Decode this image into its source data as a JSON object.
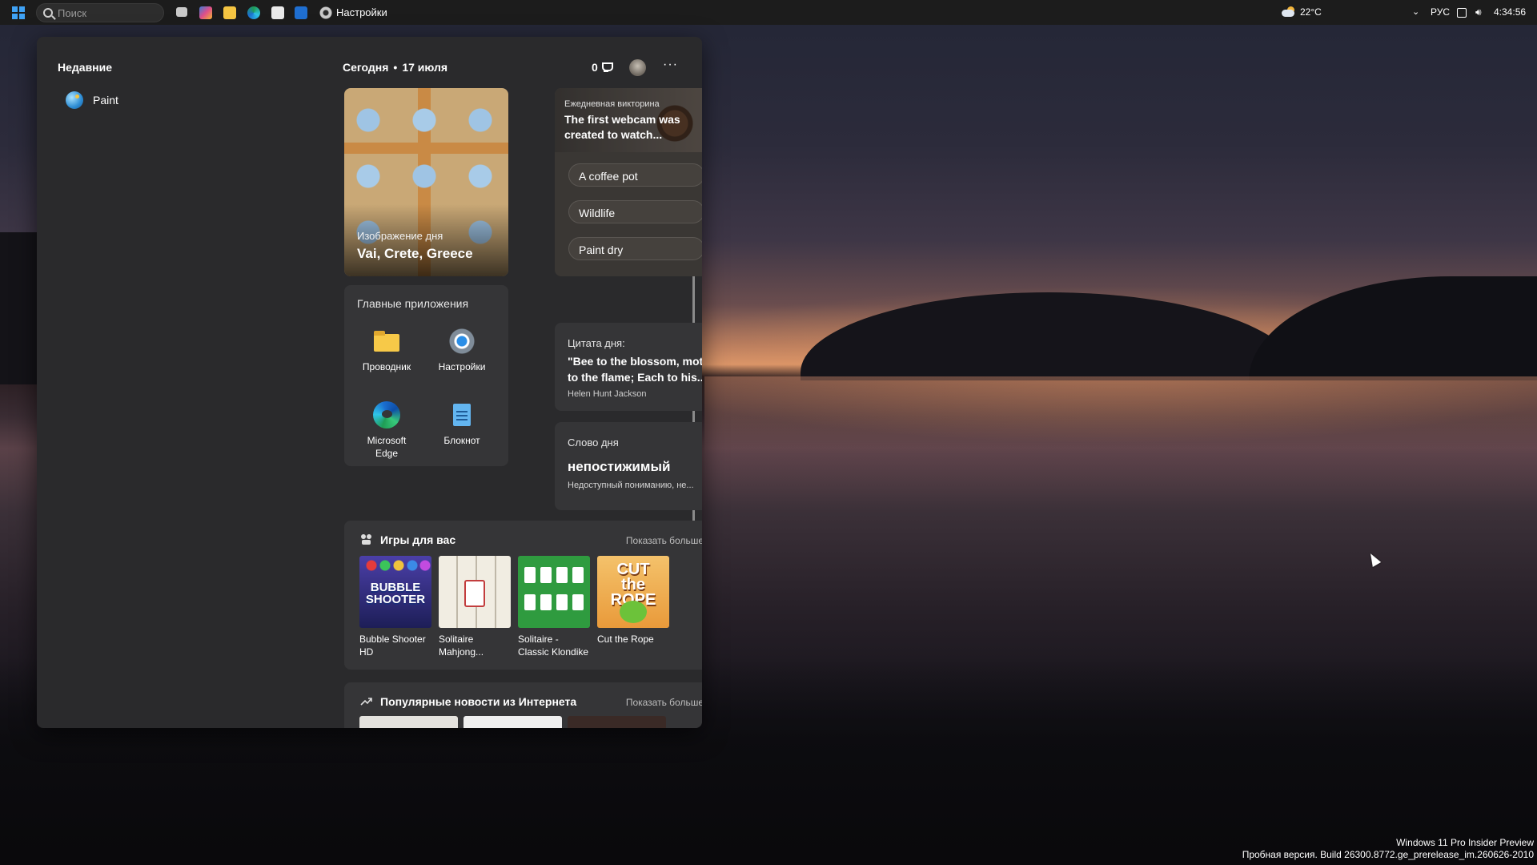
{
  "taskbar": {
    "search_placeholder": "Поиск",
    "active_app_label": "Настройки",
    "weather_temp": "22°C",
    "language": "РУС",
    "time": "4:34:56"
  },
  "widgets": {
    "recent_title": "Недавние",
    "recent_items": [
      {
        "label": "Paint",
        "icon": "paint-icon"
      }
    ],
    "header": {
      "today": "Сегодня",
      "separator": "•",
      "date": "17 июля",
      "points": "0",
      "more": "···"
    },
    "image_of_day": {
      "label": "Изображение дня",
      "title": "Vai, Crete, Greece"
    },
    "quiz": {
      "kicker": "Ежедневная викторина",
      "question": "The first webcam was created to watch...",
      "options": [
        "A coffee pot",
        "Wildlife",
        "Paint dry"
      ]
    },
    "top_apps": {
      "title": "Главные приложения",
      "apps": [
        {
          "label": "Проводник",
          "icon": "file-explorer-icon"
        },
        {
          "label": "Настройки",
          "icon": "settings-icon"
        },
        {
          "label": "Microsoft Edge",
          "icon": "edge-icon"
        },
        {
          "label": "Блокнот",
          "icon": "notepad-icon"
        }
      ]
    },
    "quote": {
      "title": "Цитата дня:",
      "text": "\"Bee to the blossom, moth to the flame; Each to his...",
      "author": "Helen Hunt Jackson"
    },
    "word": {
      "title": "Слово дня",
      "word": "непостижимый",
      "definition": "Недоступный пониманию, не..."
    },
    "games": {
      "title": "Игры для вас",
      "show_more": "Показать больше",
      "items": [
        {
          "name": "Bubble Shooter HD",
          "logo": "BUBBLE SHOOTER"
        },
        {
          "name": "Solitaire Mahjong..."
        },
        {
          "name": "Solitaire - Classic Klondike"
        },
        {
          "name": "Cut the Rope",
          "logo": "CUT the ROPE"
        }
      ]
    },
    "news": {
      "title": "Популярные новости из Интернета",
      "show_more": "Показать больше"
    }
  },
  "watermark": {
    "line1": "Windows 11 Pro Insider Preview",
    "line2": "Пробная версия. Build 26300.8772.ge_prerelease_im.260626-2010"
  },
  "colors": {
    "accent": "#3fa2f5",
    "panel_bg": "#2a2a2c",
    "card_bg": "#353537"
  }
}
